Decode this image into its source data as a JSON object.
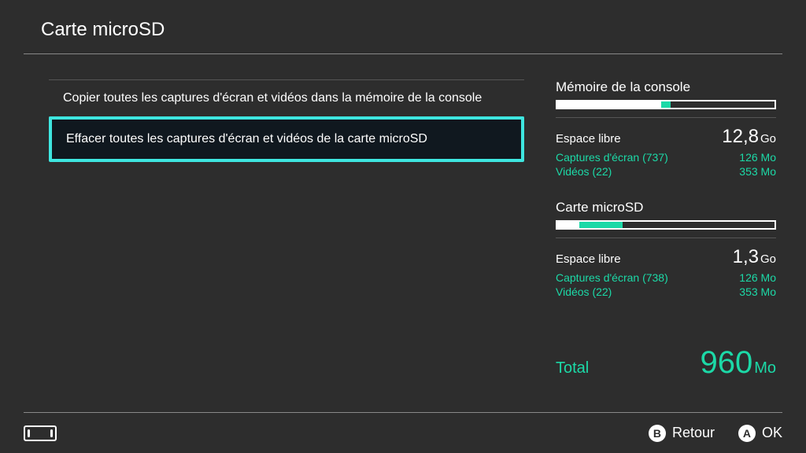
{
  "header": {
    "title": "Carte microSD"
  },
  "options": {
    "copy_all": "Copier toutes les captures d'écran et vidéos dans la mémoire de la console",
    "delete_all": "Effacer toutes les captures d'écran et vidéos de la carte microSD"
  },
  "storage": {
    "console": {
      "title": "Mémoire de la console",
      "free_label": "Espace libre",
      "free_value": "12,8",
      "free_unit": "Go",
      "bar_white_pct": 48,
      "bar_teal_pct": 4,
      "screenshots_label": "Captures d'écran (737)",
      "screenshots_value": "126 Mo",
      "videos_label": "Vidéos (22)",
      "videos_value": "353 Mo"
    },
    "sdcard": {
      "title": "Carte microSD",
      "free_label": "Espace libre",
      "free_value": "1,3",
      "free_unit": "Go",
      "bar_white_pct": 10,
      "bar_teal_pct": 20,
      "screenshots_label": "Captures d'écran (738)",
      "screenshots_value": "126 Mo",
      "videos_label": "Vidéos (22)",
      "videos_value": "353 Mo"
    },
    "total": {
      "label": "Total",
      "value": "960",
      "unit": "Mo"
    }
  },
  "footer": {
    "back_letter": "B",
    "back_label": "Retour",
    "ok_letter": "A",
    "ok_label": "OK"
  }
}
